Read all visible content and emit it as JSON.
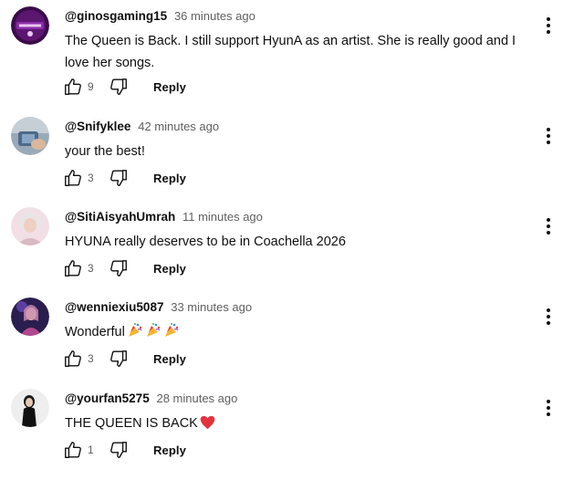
{
  "comments": [
    {
      "author": "@ginosgaming15",
      "time": "36 minutes ago",
      "text": "The Queen is Back. I still support HyunA as an artist. She is really good and I love her songs.",
      "likes": "9",
      "reply_label": "Reply",
      "avatar_colors": [
        "#3a0b4a",
        "#8a2da8"
      ]
    },
    {
      "author": "@Snifyklee",
      "time": "42 minutes ago",
      "text": "your the best!",
      "likes": "3",
      "reply_label": "Reply",
      "avatar_colors": [
        "#7c8fa0",
        "#c6cfd6"
      ]
    },
    {
      "author": "@SitiAisyahUmrah",
      "time": "11 minutes ago",
      "text": "HYUNA really deserves to be in Coachella 2026",
      "likes": "3",
      "reply_label": "Reply",
      "avatar_colors": [
        "#f2dfe6",
        "#d7b9c2"
      ]
    },
    {
      "author": "@wenniexiu5087",
      "time": "33 minutes ago",
      "text": "Wonderful",
      "emoji": [
        "party-popper-icon",
        "party-popper-icon",
        "party-popper-icon"
      ],
      "likes": "3",
      "reply_label": "Reply",
      "avatar_colors": [
        "#2a1d4f",
        "#b0498d"
      ]
    },
    {
      "author": "@yourfan5275",
      "time": "28 minutes ago",
      "text": "THE QUEEN IS BACK",
      "emoji": [
        "red-heart-icon"
      ],
      "likes": "1",
      "reply_label": "Reply",
      "avatar_colors": [
        "#eeeeee",
        "#111111"
      ]
    }
  ]
}
